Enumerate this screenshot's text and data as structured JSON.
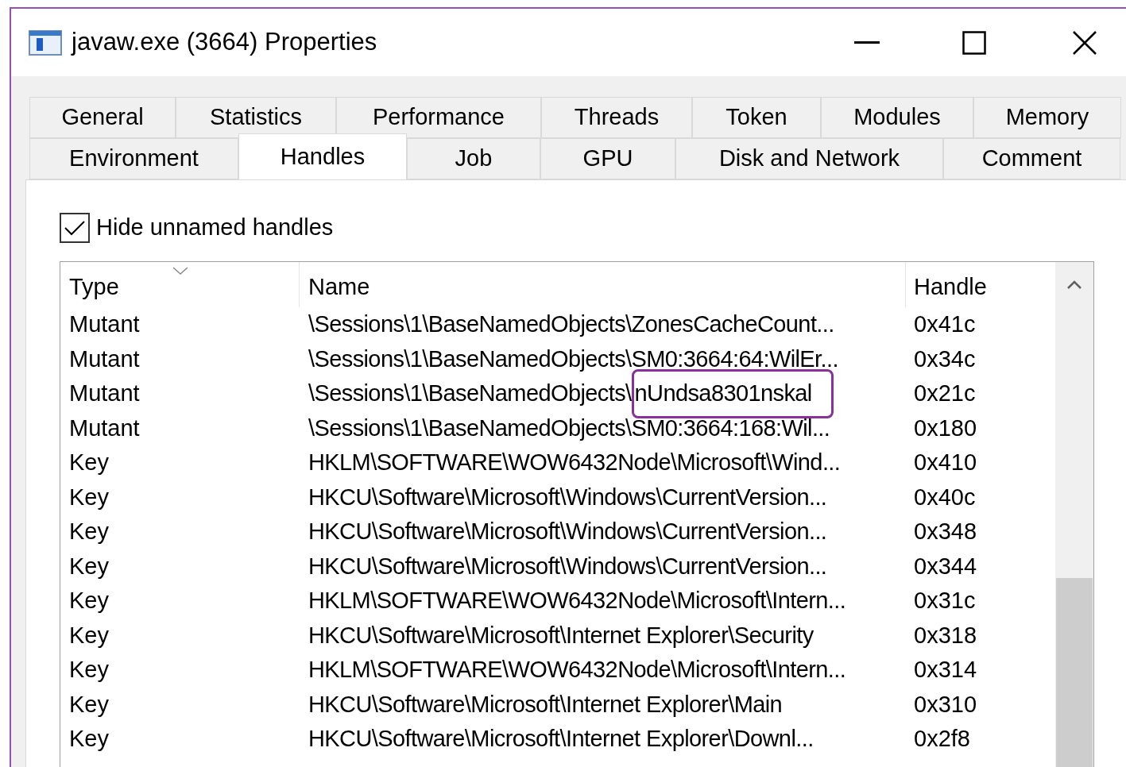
{
  "window": {
    "title": "javaw.exe (3664) Properties"
  },
  "tabs_row_1": [
    {
      "label": "General",
      "selected": false
    },
    {
      "label": "Statistics",
      "selected": false
    },
    {
      "label": "Performance",
      "selected": false
    },
    {
      "label": "Threads",
      "selected": false
    },
    {
      "label": "Token",
      "selected": false
    },
    {
      "label": "Modules",
      "selected": false
    },
    {
      "label": "Memory",
      "selected": false
    }
  ],
  "tabs_row_2": [
    {
      "label": "Environment",
      "selected": false
    },
    {
      "label": "Handles",
      "selected": true
    },
    {
      "label": "Job",
      "selected": false
    },
    {
      "label": "GPU",
      "selected": false
    },
    {
      "label": "Disk and Network",
      "selected": false
    },
    {
      "label": "Comment",
      "selected": false
    }
  ],
  "hide_unnamed": {
    "label": "Hide unnamed handles",
    "checked": true
  },
  "table": {
    "columns": [
      "Type",
      "Name",
      "Handle"
    ],
    "rows": [
      {
        "type": "Mutant",
        "name": "\\Sessions\\1\\BaseNamedObjects\\ZonesCacheCount...",
        "handle": "0x41c"
      },
      {
        "type": "Mutant",
        "name": "\\Sessions\\1\\BaseNamedObjects\\SM0:3664:64:WilEr...",
        "handle": "0x34c"
      },
      {
        "type": "Mutant",
        "name": "\\Sessions\\1\\BaseNamedObjects\\",
        "callout": "nUndsa8301nskal",
        "handle": "0x21c"
      },
      {
        "type": "Mutant",
        "name": "\\Sessions\\1\\BaseNamedObjects\\SM0:3664:168:Wil...",
        "handle": "0x180"
      },
      {
        "type": "Key",
        "name": "HKLM\\SOFTWARE\\WOW6432Node\\Microsoft\\Wind...",
        "handle": "0x410"
      },
      {
        "type": "Key",
        "name": "HKCU\\Software\\Microsoft\\Windows\\CurrentVersion...",
        "handle": "0x40c"
      },
      {
        "type": "Key",
        "name": "HKCU\\Software\\Microsoft\\Windows\\CurrentVersion...",
        "handle": "0x348"
      },
      {
        "type": "Key",
        "name": "HKCU\\Software\\Microsoft\\Windows\\CurrentVersion...",
        "handle": "0x344"
      },
      {
        "type": "Key",
        "name": "HKLM\\SOFTWARE\\WOW6432Node\\Microsoft\\Intern...",
        "handle": "0x31c"
      },
      {
        "type": "Key",
        "name": "HKCU\\Software\\Microsoft\\Internet Explorer\\Security",
        "handle": "0x318"
      },
      {
        "type": "Key",
        "name": "HKLM\\SOFTWARE\\WOW6432Node\\Microsoft\\Intern...",
        "handle": "0x314"
      },
      {
        "type": "Key",
        "name": "HKCU\\Software\\Microsoft\\Internet Explorer\\Main",
        "handle": "0x310"
      },
      {
        "type": "Key",
        "name": "HKCU\\Software\\Microsoft\\Internet Explorer\\Downl...",
        "handle": "0x2f8"
      }
    ]
  }
}
